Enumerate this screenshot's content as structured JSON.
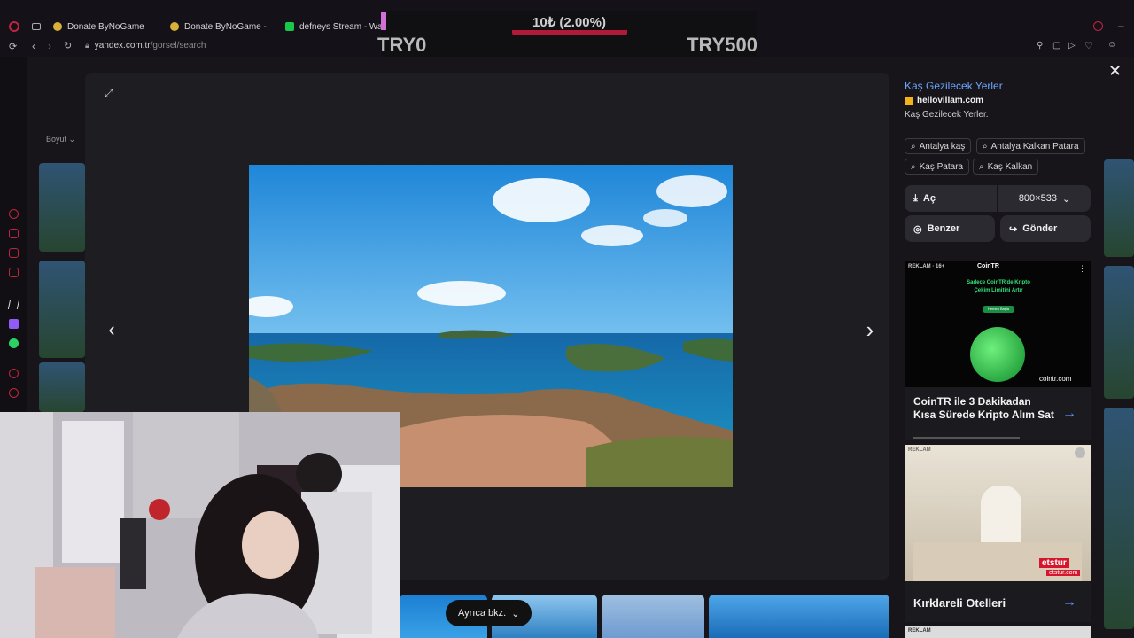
{
  "tabs": [
    {
      "label": "Donate ByNoGame",
      "icon": "bynogame-icon"
    },
    {
      "label": "Donate ByNoGame - BN",
      "icon": "bynogame-icon"
    },
    {
      "label": "defneys Stream - Watc",
      "icon": "kick-icon"
    }
  ],
  "address": {
    "host": "yandex.com.tr",
    "path": "/gorsel/search"
  },
  "donation": {
    "amount": "10₺ (2.00%)",
    "min": "TRY0",
    "max": "TRY500",
    "progress_percent": 2.0
  },
  "background": {
    "filter_label": "Boyut ⌄"
  },
  "viewer": {
    "title": "Kaş Gezilecek Yerler",
    "source": "hellovillam.com",
    "description": "Kaş Gezilecek Yerler.",
    "chips": [
      "Antalya kaş",
      "Antalya Kalkan Patara",
      "Kaş Patara",
      "Kaş Kalkan"
    ],
    "open_label": "Aç",
    "size_label": "800×533",
    "similar_label": "Benzer",
    "share_label": "Gönder",
    "also_see_label": "Ayrıca bkz."
  },
  "ads": [
    {
      "label": "REKLAM · 16+",
      "brand": "CoinTR",
      "headline": "Sadece CoinTR'de Kripto Çekim Limitini Artır",
      "cta": "Hemen Başla",
      "site": "cointr.com",
      "caption": "CoinTR ile 3 Dakikadan Kısa Sürede Kripto Alım Sat"
    },
    {
      "label": "REKLAM",
      "brand": "etstur",
      "site": "etstur.com",
      "caption": "Kırklareli Otelleri"
    },
    {
      "label": "REKLAM"
    }
  ],
  "colors": {
    "accent_link": "#6aa6ff",
    "rail_accent": "#c0243f",
    "donation_bar": "#d56fd8"
  }
}
